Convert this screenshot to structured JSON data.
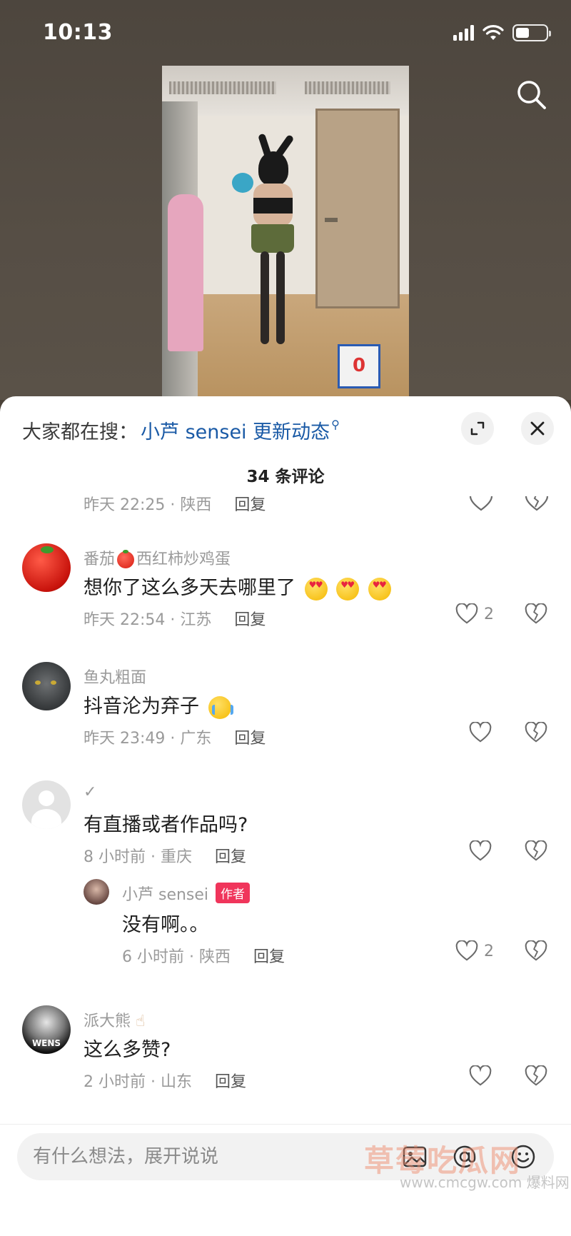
{
  "status": {
    "time": "10:13",
    "battery_level": 0.45
  },
  "sheet": {
    "hot_search_prefix": "大家都在搜：",
    "hot_search_link": "小芦 sensei 更新动态",
    "comment_count": "34 条评论"
  },
  "comments": {
    "partial": {
      "time": "昨天 22:25 · 陕西",
      "reply": "回复"
    },
    "c1": {
      "name_a": "番茄",
      "name_b": "西红柿炒鸡蛋",
      "text": "想你了这么多天去哪里了",
      "time": "昨天 22:54 · 江苏",
      "reply": "回复",
      "likes": "2"
    },
    "c2": {
      "name": "鱼丸粗面",
      "text": "抖音沦为弃子",
      "time": "昨天 23:49 · 广东",
      "reply": "回复"
    },
    "c3": {
      "name": "✓",
      "text": "有直播或者作品吗?",
      "time": "8 小时前 · 重庆",
      "reply": "回复"
    },
    "r1": {
      "name": "小芦 sensei",
      "badge": "作者",
      "text": "没有啊。。",
      "time": "6 小时前 · 陕西",
      "reply": "回复",
      "likes": "2"
    },
    "c4": {
      "name": "派大熊",
      "text": "这么多赞?",
      "time": "2 小时前 · 山东",
      "reply": "回复",
      "avatar_text": "WENS"
    }
  },
  "input": {
    "placeholder": "有什么想法，展开说说"
  },
  "watermark": {
    "main": "草莓吃瓜网",
    "sub": "www.cmcgw.com  爆料网"
  },
  "colors": {
    "link": "#1a5aa6",
    "badge": "#f0355b"
  }
}
